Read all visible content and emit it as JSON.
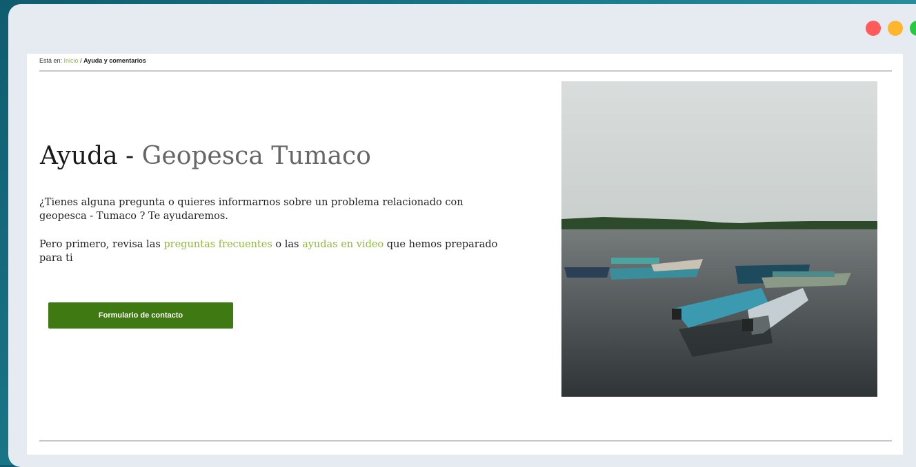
{
  "window": {
    "controls": [
      "close",
      "minimize",
      "maximize"
    ],
    "control_colors": {
      "close": "#ff5b5b",
      "minimize": "#ffb62e",
      "maximize": "#27c93f"
    }
  },
  "breadcrumb": {
    "prefix": "Está en:",
    "home": "Inicio",
    "separator": "/",
    "current": "Ayuda y comentarios"
  },
  "main": {
    "title_part1": "Ayuda - ",
    "title_part2": "Geopesca Tumaco",
    "paragraph1": "¿Tienes alguna pregunta o quieres informarnos sobre un problema relacionado con geopesca - Tumaco ? Te ayudaremos.",
    "paragraph2_start": "Pero primero, revisa las ",
    "faq_link": "preguntas frecuentes",
    "paragraph2_mid": " o las ",
    "video_link": "ayudas en video",
    "paragraph2_end": " que hemos preparado para ti",
    "contact_button": "Formulario de contacto"
  },
  "colors": {
    "accent_green": "#8dbb3f",
    "button_green": "#3e7a11"
  }
}
